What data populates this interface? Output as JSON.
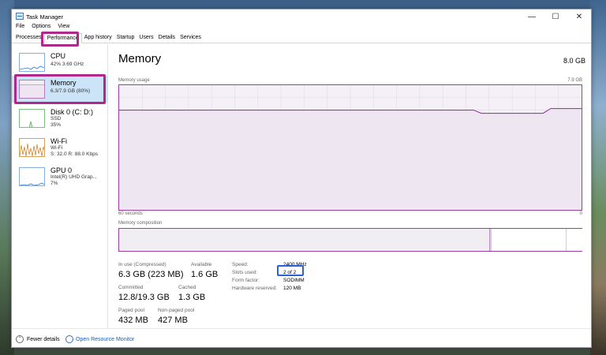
{
  "window": {
    "title": "Task Manager",
    "controls": {
      "minimize": "—",
      "maximize": "☐",
      "close": "✕"
    }
  },
  "menu": [
    "File",
    "Options",
    "View"
  ],
  "tabs": [
    {
      "label": "Processes"
    },
    {
      "label": "Performance",
      "active": true
    },
    {
      "label": "App history"
    },
    {
      "label": "Startup"
    },
    {
      "label": "Users"
    },
    {
      "label": "Details"
    },
    {
      "label": "Services"
    }
  ],
  "sidebar": [
    {
      "name": "CPU",
      "sub1": "42%  3.69 GHz",
      "sub2": "",
      "sub3": "",
      "color": "#1f7ad6"
    },
    {
      "name": "Memory",
      "sub1": "6.3/7.9 GB (80%)",
      "sub2": "",
      "sub3": "",
      "color": "#8b2a9b",
      "selected": true
    },
    {
      "name": "Disk 0 (C: D:)",
      "sub1": "SSD",
      "sub2": "35%",
      "sub3": "",
      "color": "#4caf50"
    },
    {
      "name": "Wi-Fi",
      "sub1": "Wi-Fi",
      "sub2": "S: 32.0  R: 88.0 Kbps",
      "sub3": "",
      "color": "#c27a1b"
    },
    {
      "name": "GPU 0",
      "sub1": "Intel(R) UHD Grap...",
      "sub2": "7%",
      "sub3": "",
      "color": "#1f7ad6"
    }
  ],
  "main": {
    "title": "Memory",
    "total": "8.0 GB",
    "usage_label": "Memory usage",
    "usage_max": "7.9 GB",
    "time_label": "60 seconds",
    "time_zero": "0",
    "composition_label": "Memory composition",
    "usage_fraction": 0.8
  },
  "stats": {
    "in_use_label": "In use (Compressed)",
    "in_use_value": "6.3 GB (223 MB)",
    "available_label": "Available",
    "available_value": "1.6 GB",
    "committed_label": "Committed",
    "committed_value": "12.8/19.3 GB",
    "cached_label": "Cached",
    "cached_value": "1.3 GB",
    "paged_label": "Paged pool",
    "paged_value": "432 MB",
    "nonpaged_label": "Non-paged pool",
    "nonpaged_value": "427 MB"
  },
  "details": {
    "speed_label": "Speed:",
    "speed_value": "2400 MHz",
    "slots_label": "Slots used:",
    "slots_value": "2 of 2",
    "form_label": "Form factor:",
    "form_value": "SODIMM",
    "reserved_label": "Hardware reserved:",
    "reserved_value": "120 MB"
  },
  "footer": {
    "fewer_details": "Fewer details",
    "resource_monitor": "Open Resource Monitor"
  },
  "colors": {
    "memory_accent": "#8b2a9b",
    "highlight_magenta": "#b0288c",
    "highlight_blue": "#2a62d8",
    "selected_bg": "#cce4f7"
  }
}
